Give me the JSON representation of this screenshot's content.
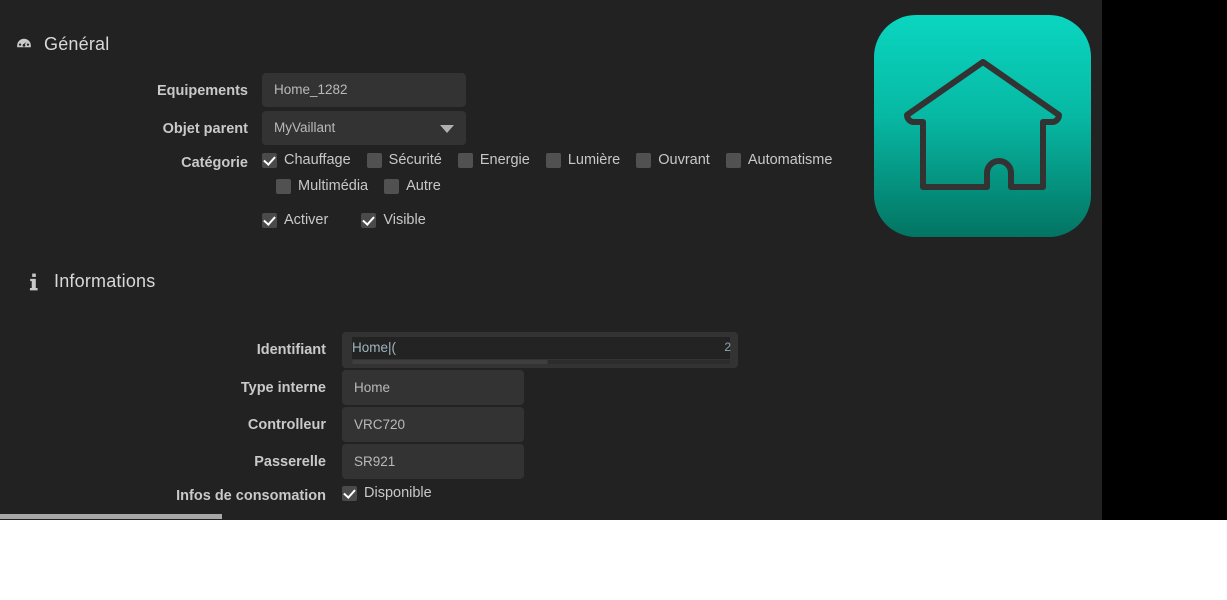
{
  "window": {
    "panel_bg": "#222222",
    "backdrop": "#000000"
  },
  "sections": {
    "general": {
      "title": "Général",
      "icon": "gauge-icon"
    },
    "informations": {
      "title": "Informations",
      "icon": "info-icon"
    }
  },
  "general": {
    "equipements": {
      "label": "Equipements",
      "value": "Home_1282",
      "placeholder": ""
    },
    "objet_parent": {
      "label": "Objet parent",
      "value": "MyVaillant",
      "caret": "chevron-down-icon"
    },
    "categorie": {
      "label": "Catégorie",
      "options": [
        {
          "label": "Chauffage",
          "checked": true
        },
        {
          "label": "Sécurité",
          "checked": false
        },
        {
          "label": "Energie",
          "checked": false
        },
        {
          "label": "Lumière",
          "checked": false
        },
        {
          "label": "Ouvrant",
          "checked": false
        },
        {
          "label": "Automatisme",
          "checked": false
        },
        {
          "label": "Multimédia",
          "checked": false
        },
        {
          "label": "Autre",
          "checked": false
        }
      ]
    },
    "state": {
      "activer": {
        "label": "Activer",
        "checked": true
      },
      "visible": {
        "label": "Visible",
        "checked": true
      }
    }
  },
  "informations": {
    "identifiant": {
      "label": "Identifiant",
      "value": "Home|(",
      "tail": "2"
    },
    "type_interne": {
      "label": "Type interne",
      "value": "Home"
    },
    "controlleur": {
      "label": "Controlleur",
      "value": "VRC720"
    },
    "passerelle": {
      "label": "Passerelle",
      "value": "SR921"
    },
    "infos_consomation": {
      "label": "Infos de consomation",
      "checkbox_label": "Disponible",
      "checked": true
    }
  },
  "device_icon": {
    "name": "house-icon",
    "gradient_top": "#0ad6c0",
    "gradient_bottom": "#037462",
    "stroke": "#333333"
  }
}
